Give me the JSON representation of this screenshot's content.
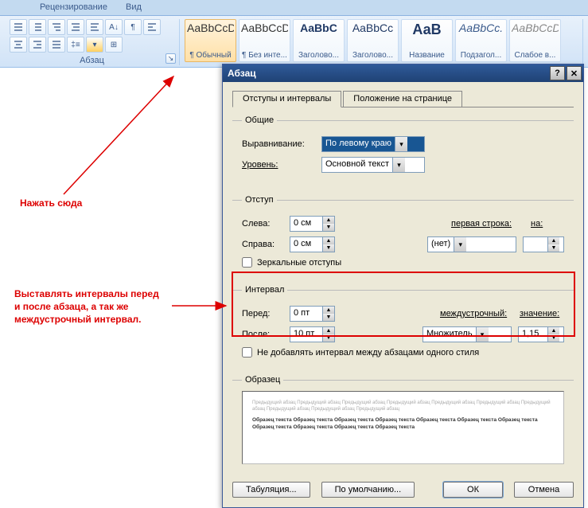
{
  "ribbonTabs": {
    "review": "Рецензирование",
    "view": "Вид"
  },
  "paragraphGroup": {
    "label": "Абзац"
  },
  "styles": [
    {
      "preview": "AaBbCcDd",
      "name": "¶ Обычный"
    },
    {
      "preview": "AaBbCcDd",
      "name": "¶ Без инте..."
    },
    {
      "preview": "AaBbC",
      "name": "Заголово..."
    },
    {
      "preview": "AaBbCc",
      "name": "Заголово..."
    },
    {
      "preview": "АаВ",
      "name": "Название"
    },
    {
      "preview": "AaBbCc.",
      "name": "Подзагол..."
    },
    {
      "preview": "AaBbCcDd",
      "name": "Слабое в..."
    }
  ],
  "dialog": {
    "title": "Абзац",
    "tabs": {
      "tab1": "Отступы и интервалы",
      "tab2": "Положение на странице"
    },
    "general": {
      "legend": "Общие",
      "alignLabel": "Выравнивание:",
      "alignValue": "По левому краю",
      "levelLabel": "Уровень:",
      "levelValue": "Основной текст"
    },
    "indent": {
      "legend": "Отступ",
      "leftLabel": "Слева:",
      "leftValue": "0 см",
      "rightLabel": "Справа:",
      "rightValue": "0 см",
      "firstLabel": "первая строка:",
      "firstValue": "(нет)",
      "byLabel": "на:",
      "byValue": "",
      "mirror": "Зеркальные отступы"
    },
    "spacing": {
      "legend": "Интервал",
      "beforeLabel": "Перед:",
      "beforeValue": "0 пт",
      "afterLabel": "После:",
      "afterValue": "10 пт",
      "lineLabel": "междустрочный:",
      "lineValue": "Множитель",
      "atLabel": "значение:",
      "atValue": "1,15",
      "nosame": "Не добавлять интервал между абзацами одного стиля"
    },
    "previewLabel": "Образец",
    "buttons": {
      "tabs": "Табуляция...",
      "default": "По умолчанию...",
      "ok": "ОК",
      "cancel": "Отмена"
    },
    "previewText": {
      "light1": "Предыдущий абзац Предыдущий абзац Предыдущий абзац Предыдущий абзац Предыдущий абзац Предыдущий абзац Предыдущий абзац Предыдущий абзац Предыдущий абзац Предыдущий абзац",
      "dark": "Образец текста Образец текста Образец текста Образец текста Образец текста Образец текста Образец текста Образец текста Образец текста Образец текста Образец текста",
      "light2": ""
    }
  },
  "annotations": {
    "click": "Нажать сюда",
    "interval1": "Выставлять интервалы перед",
    "interval2": "и после абзаца, а так же",
    "interval3": "междустрочный интервал."
  }
}
